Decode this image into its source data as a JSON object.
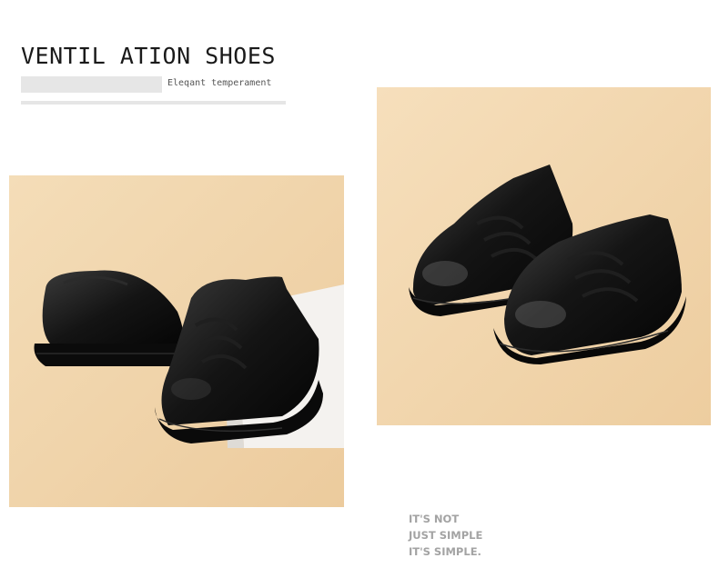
{
  "header": {
    "title": "VENTIL ATION SHOES",
    "subtitle": "Eleqant temperament"
  },
  "photos": {
    "left_alt": "Pair of black leather lace-up children's shoes on beige backdrop",
    "right_alt": "Pair of black leather lace-up children's shoes, front view"
  },
  "tagline": {
    "line1": "IT'S NOT",
    "line2": "JUST SIMPLE",
    "line3": "IT'S SIMPLE."
  },
  "colors": {
    "background_beige": "#f1d7b0",
    "shoe_black": "#111111",
    "tagline_grey": "#a3a3a3"
  }
}
